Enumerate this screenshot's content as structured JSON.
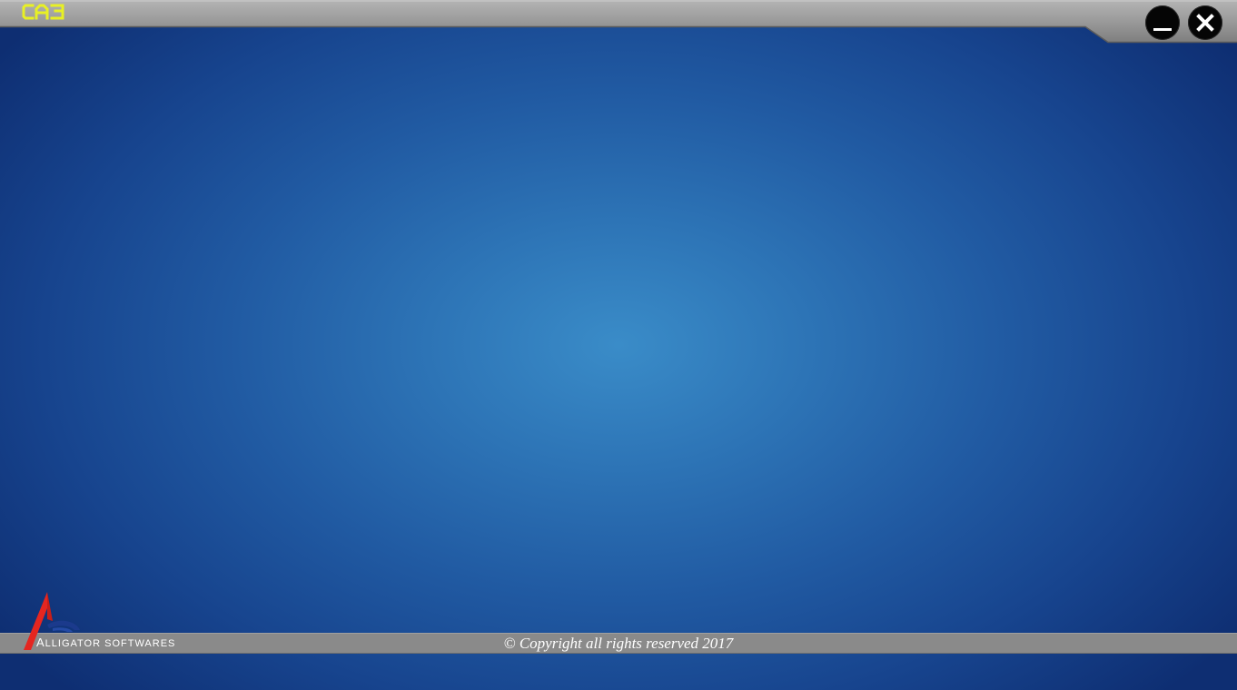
{
  "app": {
    "logo_text": "CA3"
  },
  "window_controls": {
    "minimize_label": "Minimize",
    "close_label": "Close"
  },
  "footer": {
    "company_initial": "A",
    "company_name_rest": "LLIGATOR SOFTWARES",
    "copyright": "© Copyright all rights reserved 2017"
  },
  "colors": {
    "background_center": "#3a8cc8",
    "background_edge": "#0e2e72",
    "logo_yellow": "#e8f024",
    "titlebar_gray": "#9c9c9c",
    "footer_gray": "#8a8a8a",
    "brand_red": "#e52620"
  }
}
